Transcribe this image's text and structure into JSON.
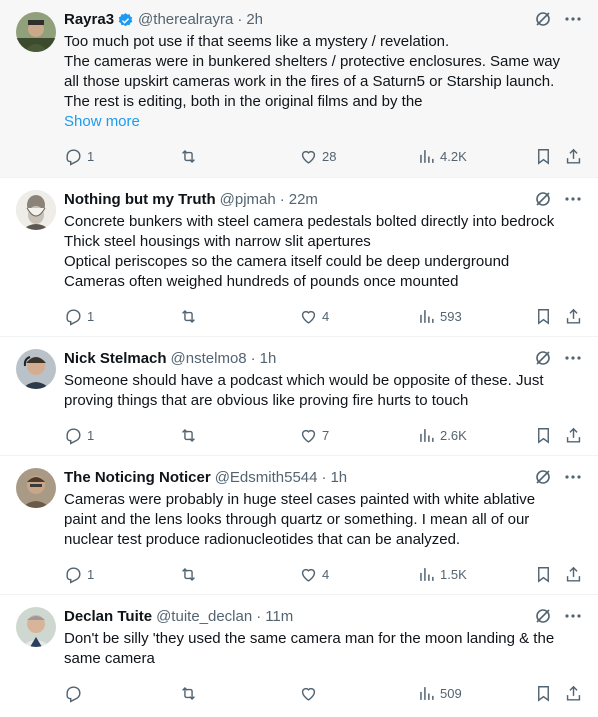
{
  "tweets": [
    {
      "name": "Rayra3",
      "verified": true,
      "handle": "@therealrayra",
      "time": "2h",
      "lines": [
        "Too much pot use if that seems like a mystery / revelation.",
        "The cameras were in bunkered shelters / protective enclosures. Same way",
        "all those upskirt cameras work in the fires of a Saturn5 or Starship launch.",
        "The rest is editing, both in the original films and by the"
      ],
      "show_more": "Show more",
      "replies": "1",
      "retweets": "",
      "likes": "28",
      "views": "4.2K"
    },
    {
      "name": "Nothing but my Truth",
      "verified": false,
      "handle": "@pjmah",
      "time": "22m",
      "lines": [
        "Concrete bunkers with steel camera pedestals bolted directly into bedrock",
        "Thick steel housings with narrow slit apertures",
        "Optical periscopes so the camera itself could be deep underground",
        "Cameras often weighed hundreds of pounds once mounted"
      ],
      "replies": "1",
      "retweets": "",
      "likes": "4",
      "views": "593"
    },
    {
      "name": "Nick Stelmach",
      "verified": false,
      "handle": "@nstelmo8",
      "time": "1h",
      "lines": [
        "Someone should have a podcast which would be opposite of these. Just",
        "proving things that are obvious like proving fire hurts to touch"
      ],
      "replies": "1",
      "retweets": "",
      "likes": "7",
      "views": "2.6K"
    },
    {
      "name": "The Noticing Noticer",
      "verified": false,
      "handle": "@Edsmith5544",
      "time": "1h",
      "lines": [
        "Cameras were probably in huge steel cases painted with white ablative",
        "paint and the lens looks through quartz or something.  I mean all of our",
        "nuclear test produce radionucleotides that can be analyzed."
      ],
      "replies": "1",
      "retweets": "",
      "likes": "4",
      "views": "1.5K"
    },
    {
      "name": "Declan Tuite",
      "verified": false,
      "handle": "@tuite_declan",
      "time": "11m",
      "lines": [
        "Don't be silly 'they used  the same camera man for the moon landing & the",
        "same  camera"
      ],
      "replies": "",
      "retweets": "",
      "likes": "",
      "views": "509"
    }
  ],
  "colors": {
    "text": "#0f1419",
    "secondary": "#536471",
    "link": "#1d9bf0",
    "verified": "#1d9bf0",
    "divider": "#eff3f4"
  }
}
